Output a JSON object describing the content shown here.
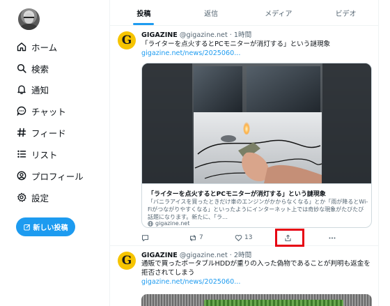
{
  "sidebar": {
    "items": [
      {
        "label": "ホーム",
        "icon": "home-icon"
      },
      {
        "label": "検索",
        "icon": "search-icon"
      },
      {
        "label": "通知",
        "icon": "bell-icon"
      },
      {
        "label": "チャット",
        "icon": "chat-icon"
      },
      {
        "label": "フィード",
        "icon": "hash-icon"
      },
      {
        "label": "リスト",
        "icon": "list-icon"
      },
      {
        "label": "プロフィール",
        "icon": "profile-icon"
      },
      {
        "label": "設定",
        "icon": "gear-icon"
      }
    ],
    "post_button": "新しい投稿"
  },
  "tabs": [
    {
      "label": "投稿",
      "active": true
    },
    {
      "label": "返信",
      "active": false
    },
    {
      "label": "メディア",
      "active": false
    },
    {
      "label": "ビデオ",
      "active": false
    }
  ],
  "posts": [
    {
      "logo_letter": "G",
      "name": "GIGAZINE",
      "meta": "@gigazine.net · 1時間",
      "text": "「ライターを点火するとPCモニターが消灯する」という謎現象",
      "link": "gigazine.net/news/2025060...",
      "card": {
        "title": "「ライターを点火するとPCモニターが消灯する」という謎現象",
        "description": "「バニラアイスを買ったときだけ車のエンジンがかからなくなる」とか「雨が降るとWi-Fiがつながりやすくなる」といったようにインターネット上では奇妙な現象がたびたび話題になります。新たに、「ラ…",
        "domain": "gigazine.net"
      },
      "actions": {
        "replies": "",
        "reposts": "7",
        "likes": "13"
      }
    },
    {
      "logo_letter": "G",
      "name": "GIGAZINE",
      "meta": "@gigazine.net · 2時間",
      "text": "通販で買ったポータブルHDDが重りの入った偽物であることが判明も返金を拒否されてしまう",
      "link": "gigazine.net/news/2025060..."
    }
  ],
  "colors": {
    "accent": "#1d9bf0",
    "highlight": "#e60012",
    "logo": "#f6c400"
  }
}
